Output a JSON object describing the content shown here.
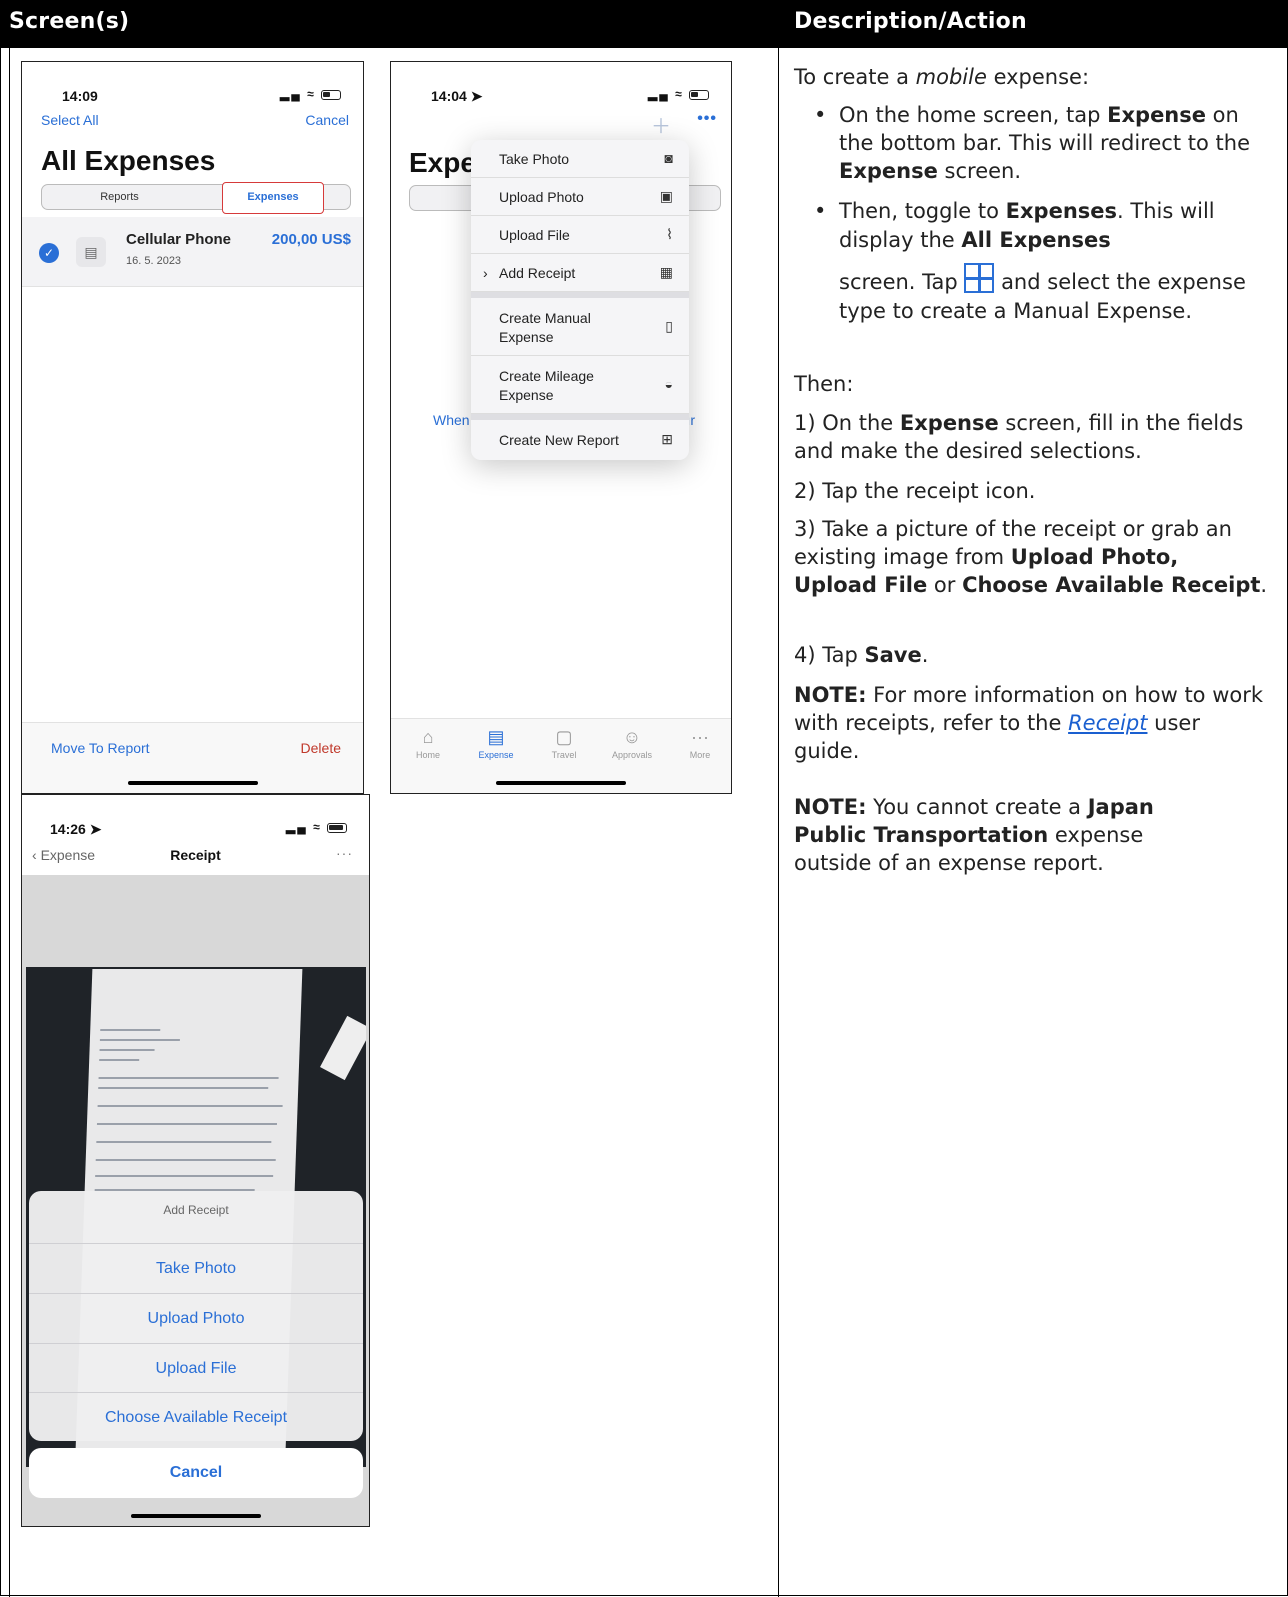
{
  "header": {
    "col1": "Screen(s)",
    "col2": "Description/Action"
  },
  "phone1": {
    "time": "14:09",
    "select_all": "Select All",
    "cancel": "Cancel",
    "title": "All Expenses",
    "seg_reports": "Reports",
    "seg_expenses": "Expenses",
    "row": {
      "name": "Cellular Phone",
      "amount": "200,00 US$",
      "date": "16. 5. 2023"
    },
    "move_to_report": "Move To Report",
    "delete": "Delete"
  },
  "phone2": {
    "time": "14:04",
    "bg_title": "Expe",
    "bg_text_left": "When",
    "bg_text_right": "ır",
    "menu": {
      "take_photo": "Take Photo",
      "upload_photo": "Upload Photo",
      "upload_file": "Upload File",
      "add_receipt": "Add Receipt",
      "manual_1": "Create Manual",
      "manual_2": "Expense",
      "mileage_1": "Create Mileage",
      "mileage_2": "Expense",
      "new_report": "Create New Report"
    },
    "tabs": {
      "home": "Home",
      "expense": "Expense",
      "travel": "Travel",
      "approvals": "Approvals",
      "more": "More"
    }
  },
  "phone3": {
    "time": "14:26",
    "back": "Expense",
    "title": "Receipt",
    "sheet_title": "Add Receipt",
    "opt_take_photo": "Take Photo",
    "opt_upload_photo": "Upload Photo",
    "opt_upload_file": "Upload File",
    "opt_choose": "Choose Available Receipt",
    "cancel": "Cancel"
  },
  "desc": {
    "intro_a": "To create a ",
    "intro_em": "mobile",
    "intro_b": " expense:",
    "b1_a": "On the home screen, tap ",
    "b1_bold": "Expense",
    "b1_b": " on the bottom bar. This will redirect to the ",
    "b1_bold2": "Expense",
    "b1_c": " screen.",
    "b2_a": "Then, toggle to ",
    "b2_bold": "Expenses",
    "b2_b": ". This will display the ",
    "b2_bold2": "All Expenses",
    "b2_c": "screen. Tap ",
    "b2_d": " and select the expense type to create a Manual Expense.",
    "then": "Then:",
    "s1_a": "1) On the ",
    "s1_bold": "Expense",
    "s1_b": " screen, fill in the fields and make the desired selections.",
    "s2": "2) Tap the receipt icon.",
    "s3_a": "3) Take a picture of the receipt or grab an existing image from ",
    "s3_b1": "Upload Photo,",
    "s3_b2": "Upload File",
    "s3_or": " or ",
    "s3_b3": "Choose Available Receipt",
    "s3_end": ".",
    "s4_a": "4) Tap ",
    "s4_bold": "Save",
    "s4_end": ".",
    "n1_label": "NOTE:",
    "n1_a": " For more information on how to work with receipts, refer to the ",
    "n1_link": "Receipt",
    "n1_b": " user guide.",
    "n2_label": "NOTE:",
    "n2_a": " You cannot create a ",
    "n2_bold": "Japan Public Transportation",
    "n2_b": " expense outside of an expense report."
  }
}
